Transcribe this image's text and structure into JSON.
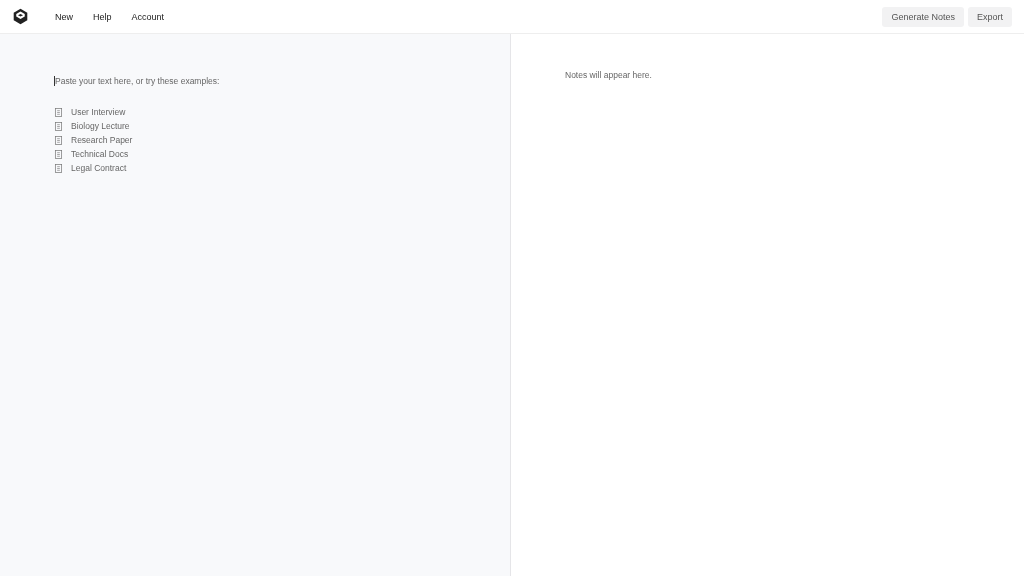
{
  "nav": {
    "items": [
      "New",
      "Help",
      "Account"
    ]
  },
  "actions": [
    "Generate Notes",
    "Export"
  ],
  "editor": {
    "placeholder": "Paste your text here, or try these examples:",
    "examples": [
      "User Interview",
      "Biology Lecture",
      "Research Paper",
      "Technical Docs",
      "Legal Contract"
    ]
  },
  "notes": {
    "placeholder": "Notes will appear here."
  }
}
